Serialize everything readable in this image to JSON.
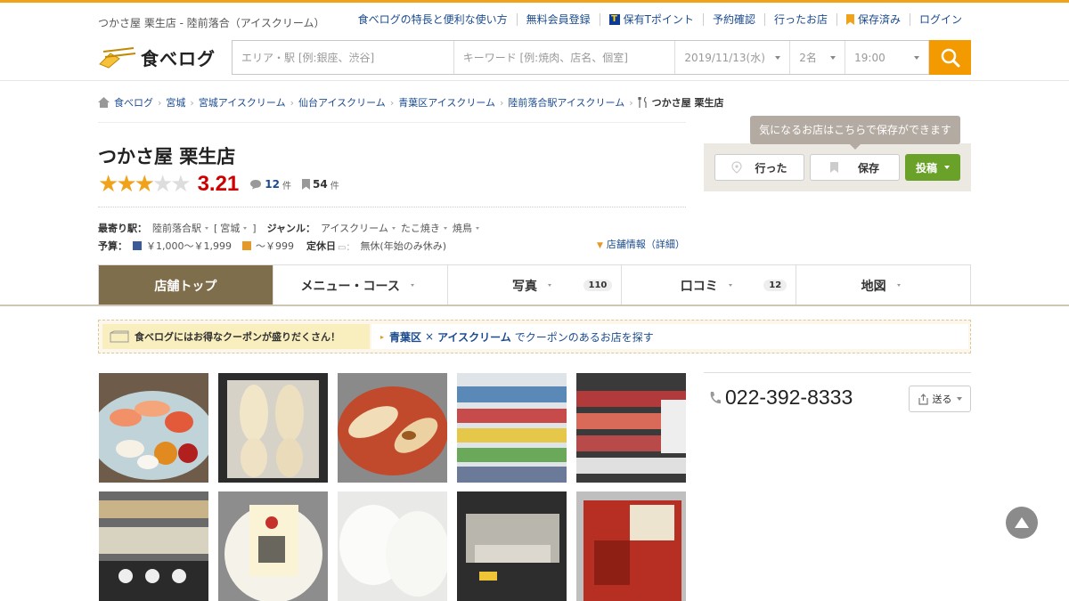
{
  "header": {
    "site_title": "つかさ屋 栗生店 - 陸前落合（アイスクリーム）",
    "links": [
      "食べログの特長と便利な使い方",
      "無料会員登録",
      "保有Tポイント",
      "予約確認",
      "行ったお店",
      "保存済み",
      "ログイン"
    ],
    "logo_text": "食べログ",
    "search": {
      "area_placeholder": "エリア・駅 [例:銀座、渋谷]",
      "keyword_placeholder": "キーワード [例:焼肉、店名、個室]",
      "date": "2019/11/13(水)",
      "people": "2名",
      "time": "19:00"
    }
  },
  "breadcrumb": [
    "食べログ",
    "宮城",
    "宮城アイスクリーム",
    "仙台アイスクリーム",
    "青葉区アイスクリーム",
    "陸前落合駅アイスクリーム",
    "つかさ屋 栗生店"
  ],
  "restaurant": {
    "name": "つかさ屋 栗生店",
    "score": "3.21",
    "stars_on": 3,
    "reviews": "12",
    "reviews_unit": "件",
    "saves": "54",
    "saves_unit": "件",
    "station_label": "最寄り駅：",
    "station": "陸前落合駅",
    "pref": "宮城",
    "genre_label": "ジャンル：",
    "genres": [
      "アイスクリーム",
      "たこ焼き",
      "焼鳥"
    ],
    "budget_label": "予算：",
    "budget_dinner": "￥1,000～￥1,999",
    "budget_lunch": "～￥999",
    "holiday_label": "定休日",
    "holiday": "無休(年始のみ休み)",
    "detail_link": "店舗情報（詳細）"
  },
  "save_panel": {
    "tooltip": "気になるお店はこちらで保存ができます",
    "went": "行った",
    "save": "保存",
    "post": "投稿"
  },
  "tabs": [
    {
      "label": "店舗トップ",
      "count": ""
    },
    {
      "label": "メニュー・コース",
      "count": ""
    },
    {
      "label": "写真",
      "count": "110"
    },
    {
      "label": "口コミ",
      "count": "12"
    },
    {
      "label": "地図",
      "count": ""
    }
  ],
  "coupon": {
    "left": "食べログにはお得なクーポンが盛りだくさん！",
    "area": "青葉区",
    "x": "×",
    "genre": "アイスクリーム",
    "tail": "でクーポンのあるお店を探す"
  },
  "photos": [
    "sushi",
    "frozen-fish",
    "grilled-rice-cakes",
    "drinks-shelf",
    "seafood-shelf",
    "deli-case",
    "tamago-mochi-pack",
    "white-buns",
    "empty-shelf",
    "kimchi-pack"
  ],
  "contact": {
    "phone": "022-392-8333",
    "send": "送る"
  },
  "colors": {
    "accent": "#f39a00",
    "score_red": "#cc0000",
    "tab_active": "#7f6e4c",
    "post_green": "#6aa229"
  }
}
